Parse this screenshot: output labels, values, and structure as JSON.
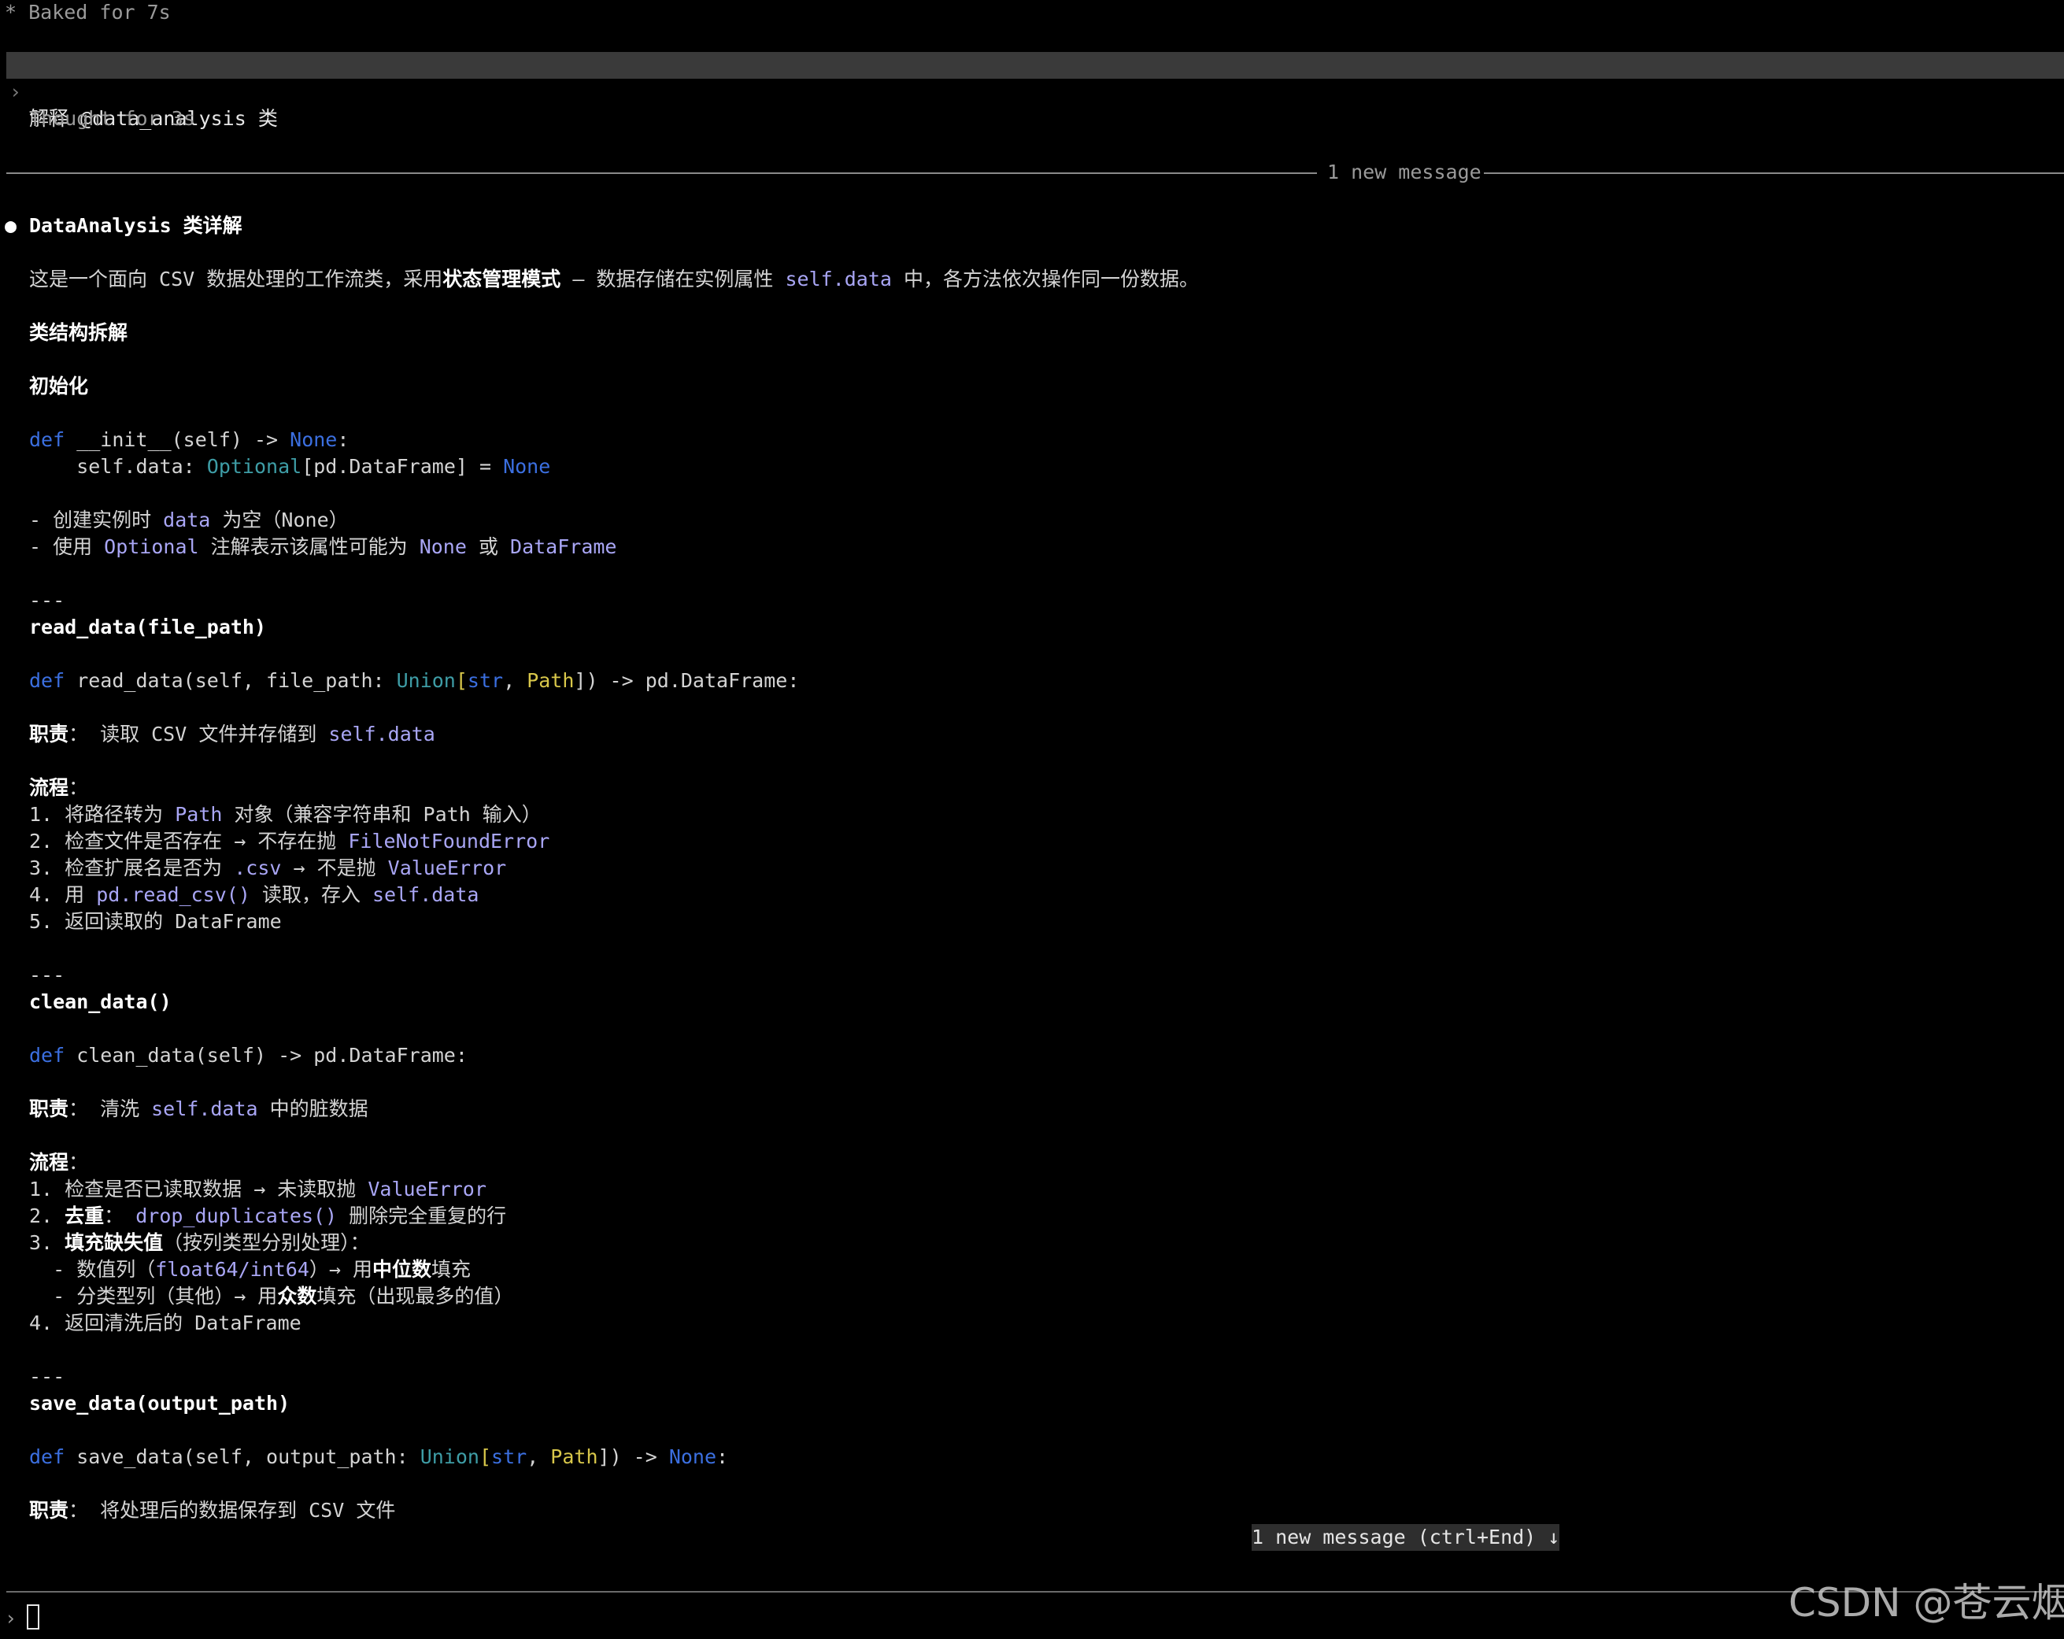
{
  "status": {
    "text": "* Baked for 7s"
  },
  "user_prompt": {
    "chevron": "›",
    "text": "解释 @data_analysis 类"
  },
  "thought": {
    "text": "Thought for 3s"
  },
  "divider": {
    "label": "1 new message"
  },
  "message": {
    "bullet": "●",
    "title": "DataAnalysis 类详解",
    "intro": {
      "p1": "这是一个面向 CSV 数据处理的工作流类，采用",
      "p2": "状态管理模式",
      "p3": " — 数据存储在实例属性 ",
      "p4": "self.data",
      "p5": " 中，各方法依次操作同一份数据。"
    },
    "section_title": "类结构拆解",
    "init": {
      "heading": "初始化",
      "code1": {
        "kw": "def",
        "a": " __init__(self) -> ",
        "none": "None",
        "b": ":"
      },
      "code2": {
        "a": "    self.data: ",
        "ty": "Optional",
        "b": "[pd.DataFrame] = ",
        "none": "None"
      },
      "b1": {
        "a": "- 创建实例时 ",
        "code": "data",
        "b": " 为空（None）"
      },
      "b2": {
        "a": "- 使用 ",
        "code1": "Optional",
        "b": " 注解表示该属性可能为 ",
        "code2": "None",
        "c": " 或 ",
        "code3": "DataFrame"
      }
    },
    "sep": "---",
    "read": {
      "heading": "read_data(file_path)",
      "code": {
        "kw": "def",
        "a": " read_data(self, file_path: ",
        "ty": "Union",
        "b": "[",
        "str": "str",
        "c": ", ",
        "path": "Path",
        "d": "]) -> pd.DataFrame:"
      },
      "duty": {
        "label": "职责",
        "a": "： 读取 CSV 文件并存储到 ",
        "code": "self.data"
      },
      "flow_label": "流程",
      "flow_colon": "：",
      "s1": {
        "a": "1. 将路径转为 ",
        "code": "Path",
        "b": " 对象（兼容字符串和 Path 输入）"
      },
      "s2": {
        "a": "2. 检查文件是否存在 → 不存在抛 ",
        "code": "FileNotFoundError"
      },
      "s3": {
        "a": "3. 检查扩展名是否为 ",
        "code1": ".csv",
        "b": " → 不是抛 ",
        "code2": "ValueError"
      },
      "s4": {
        "a": "4. 用 ",
        "code1": "pd.read_csv()",
        "b": " 读取，存入 ",
        "code2": "self.data"
      },
      "s5": {
        "a": "5. 返回读取的 DataFrame"
      }
    },
    "clean": {
      "heading": "clean_data()",
      "code": {
        "kw": "def",
        "a": " clean_data(self) -> pd.DataFrame:"
      },
      "duty": {
        "label": "职责",
        "a": "： 清洗 ",
        "code": "self.data",
        "b": " 中的脏数据"
      },
      "flow_label": "流程",
      "flow_colon": "：",
      "s1": {
        "a": "1. 检查是否已读取数据 → 未读取抛 ",
        "code": "ValueError"
      },
      "s2": {
        "a": "2. ",
        "bold": "去重",
        "b": "： ",
        "code": "drop_duplicates()",
        "c": " 删除完全重复的行"
      },
      "s3": {
        "a": "3. ",
        "bold": "填充缺失值",
        "b": "（按列类型分别处理）："
      },
      "s3a": {
        "a": "  - 数值列（",
        "code": "float64/int64",
        "b": "）→ 用",
        "bold": "中位数",
        "c": "填充"
      },
      "s3b": {
        "a": "  - 分类型列（其他）→ 用",
        "bold": "众数",
        "b": "填充（出现最多的值）"
      },
      "s4": {
        "a": "4. 返回清洗后的 DataFrame"
      }
    },
    "save": {
      "heading": "save_data(output_path)",
      "code": {
        "kw": "def",
        "a": " save_data(self, output_path: ",
        "ty": "Union",
        "b": "[",
        "str": "str",
        "c": ", ",
        "path": "Path",
        "d": "]) -> ",
        "none": "None",
        "e": ":"
      },
      "duty": {
        "label": "职责",
        "a": "： 将处理后的数据保存到 CSV 文件"
      }
    }
  },
  "new_message_badge": {
    "text": "1 new message (ctrl+End) ↓"
  },
  "input": {
    "chevron": "›"
  },
  "watermark": {
    "text": "CSDN @苍云烟"
  },
  "colors": {
    "background": "#000000",
    "keyword": "#3b6fe0",
    "type": "#3e9da6",
    "string_type": "#d8c74a",
    "inline_code": "#a9a6f5",
    "prompt_bar": "#3a3a3a"
  }
}
